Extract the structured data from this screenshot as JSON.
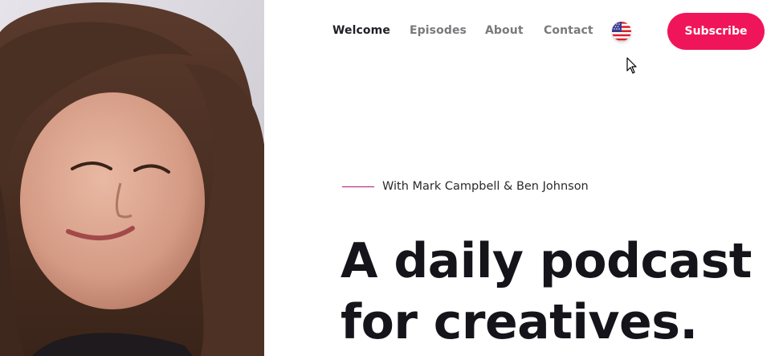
{
  "nav": {
    "links": [
      {
        "label": "Welcome",
        "active": true
      },
      {
        "label": "Episodes",
        "active": false
      },
      {
        "label": "About",
        "active": false
      },
      {
        "label": "Contact",
        "active": false
      }
    ],
    "language_icon": "us-flag-icon",
    "subscribe_label": "Subscribe"
  },
  "hero": {
    "hosts": "With Mark Campbell & Ben Johnson",
    "headline_line1": "A daily podcast",
    "headline_line2": "for creatives."
  },
  "colors": {
    "accent": "#f0155a",
    "hosts_line": "#b0157a",
    "text_dark": "#14141a",
    "nav_muted": "#7a7a7e"
  }
}
